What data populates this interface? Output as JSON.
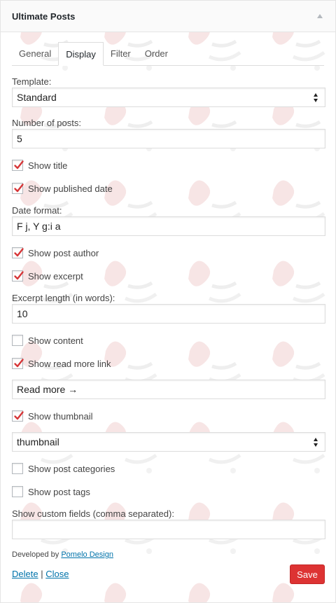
{
  "widget": {
    "title": "Ultimate Posts"
  },
  "tabs": [
    {
      "label": "General",
      "active": false
    },
    {
      "label": "Display",
      "active": true
    },
    {
      "label": "Filter",
      "active": false
    },
    {
      "label": "Order",
      "active": false
    }
  ],
  "form": {
    "template": {
      "label": "Template:",
      "value": "Standard"
    },
    "number_of_posts": {
      "label": "Number of posts:",
      "value": "5"
    },
    "show_title": {
      "label": "Show title",
      "checked": true
    },
    "show_published_date": {
      "label": "Show published date",
      "checked": true
    },
    "date_format": {
      "label": "Date format:",
      "value": "F j, Y g:i a"
    },
    "show_post_author": {
      "label": "Show post author",
      "checked": true
    },
    "show_excerpt": {
      "label": "Show excerpt",
      "checked": true
    },
    "excerpt_length": {
      "label": "Excerpt length (in words):",
      "value": "10"
    },
    "show_content": {
      "label": "Show content",
      "checked": false
    },
    "show_read_more_link": {
      "label": "Show read more link",
      "checked": true
    },
    "read_more_text": {
      "value": "Read more →"
    },
    "show_thumbnail": {
      "label": "Show thumbnail",
      "checked": true
    },
    "thumbnail_size": {
      "value": "thumbnail"
    },
    "show_post_categories": {
      "label": "Show post categories",
      "checked": false
    },
    "show_post_tags": {
      "label": "Show post tags",
      "checked": false
    },
    "custom_fields": {
      "label": "Show custom fields (comma separated):",
      "value": ""
    }
  },
  "footer": {
    "developed_by": "Developed by",
    "developer_link": "Pomelo Design",
    "delete_label": "Delete",
    "separator": "|",
    "close_label": "Close",
    "save_label": "Save"
  },
  "colors": {
    "check_mark": "#d63638",
    "save_button": "#dd3333",
    "link": "#0073aa"
  }
}
